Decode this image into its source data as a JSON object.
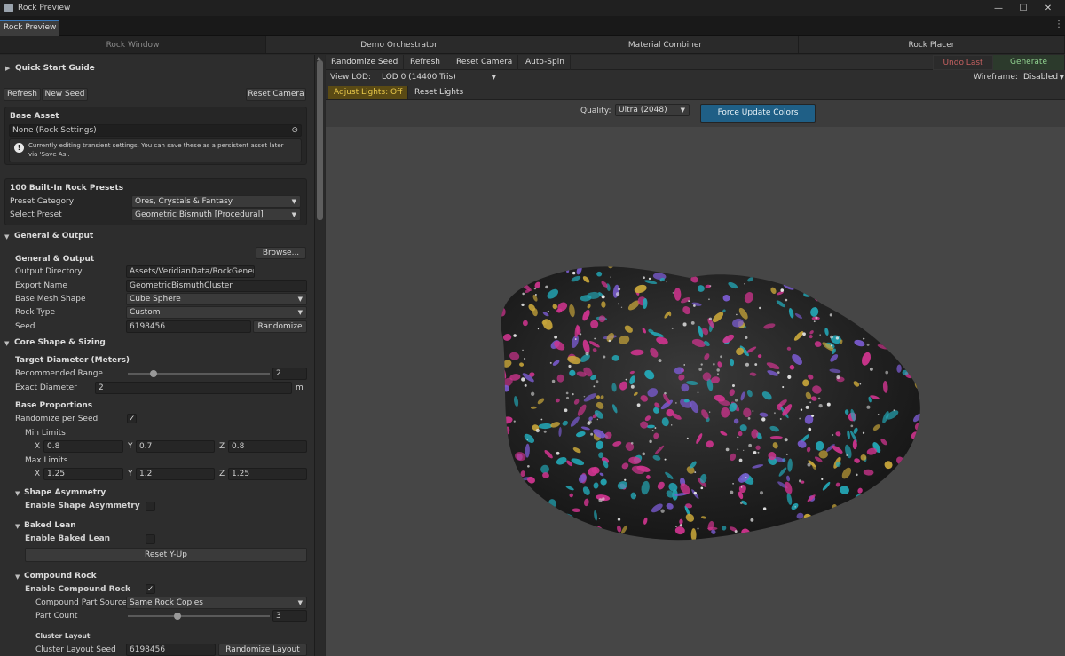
{
  "window": {
    "title": "Rock Preview",
    "controls": {
      "minimize": "—",
      "maximize": "☐",
      "close": "✕"
    }
  },
  "tabs": {
    "active": "Rock Preview",
    "menu": "⋮"
  },
  "nav": {
    "items": [
      "Rock Window",
      "Demo Orchestrator",
      "Material Combiner",
      "Rock Placer"
    ]
  },
  "left": {
    "quick_start": "Quick Start Guide",
    "buttons": {
      "refresh": "Refresh",
      "new_seed": "New Seed",
      "reset_camera": "Reset Camera"
    },
    "base_asset": {
      "title": "Base Asset",
      "value": "None (Rock Settings)",
      "info_line1": "Currently editing transient settings. You can save these as a persistent asset later",
      "info_line2": "via 'Save As'."
    },
    "presets": {
      "title": "100 Built-In Rock Presets",
      "category_label": "Preset Category",
      "category_value": "Ores, Crystals & Fantasy",
      "preset_label": "Select Preset",
      "preset_value": "Geometric Bismuth [Procedural]"
    },
    "general": {
      "section": "General & Output",
      "browse": "Browse...",
      "sub": "General & Output",
      "output_dir_label": "Output Directory",
      "output_dir_value": "Assets/VeridianData/RockGenera",
      "export_label": "Export Name",
      "export_value": "GeometricBismuthCluster",
      "mesh_label": "Base Mesh Shape",
      "mesh_value": "Cube Sphere",
      "type_label": "Rock Type",
      "type_value": "Custom",
      "seed_label": "Seed",
      "seed_value": "6198456",
      "randomize": "Randomize"
    },
    "core": {
      "section": "Core Shape & Sizing",
      "target": "Target Diameter (Meters)",
      "range_label": "Recommended Range",
      "range_value": "2",
      "range_fraction": 0.18,
      "exact_label": "Exact Diameter",
      "exact_value": "2",
      "exact_unit": "m",
      "proportions": "Base Proportions",
      "rand_label": "Randomize per Seed",
      "rand_checked": true,
      "min": "Min Limits",
      "max": "Max Limits",
      "x": "X",
      "y": "Y",
      "z": "Z",
      "min_x": "0.8",
      "min_y": "0.7",
      "min_z": "0.8",
      "max_x": "1.25",
      "max_y": "1.2",
      "max_z": "1.25"
    },
    "asym": {
      "section": "Shape Asymmetry",
      "enable": "Enable Shape Asymmetry",
      "checked": false
    },
    "lean": {
      "section": "Baked Lean",
      "enable": "Enable Baked Lean",
      "checked": false,
      "reset": "Reset Y-Up"
    },
    "compound": {
      "section": "Compound Rock",
      "enable": "Enable Compound Rock",
      "checked": true,
      "source_label": "Compound Part Source",
      "source_value": "Same Rock Copies",
      "count_label": "Part Count",
      "count_value": "3",
      "count_fraction": 0.35,
      "cluster": "Cluster Layout",
      "cluster_seed_label": "Cluster Layout Seed",
      "cluster_seed_value": "6198456",
      "randomize_layout": "Randomize Layout"
    }
  },
  "toolbar": {
    "randomize_seed": "Randomize Seed",
    "refresh": "Refresh",
    "reset_camera": "Reset Camera",
    "auto_spin": "Auto-Spin",
    "undo_last": "Undo Last",
    "generate_prefab": "Generate Prefab",
    "view_lod_label": "View LOD:",
    "view_lod_value": "LOD 0 (14400 Tris)",
    "wireframe_label": "Wireframe:",
    "wireframe_value": "Disabled",
    "adjust_lights": "Adjust Lights: Off",
    "reset_lights": "Reset Lights",
    "quality_label": "Quality:",
    "quality_value": "Ultra (2048)",
    "force_update": "Force Update Colors"
  },
  "colors": {
    "accent_blue": "#1f5f86",
    "adjust_bg": "#5a4a14",
    "undo_text": "#c46060",
    "generate_text": "#8fd08f",
    "spot_pink": "#d0348f",
    "spot_cyan": "#23a9b8",
    "spot_gold": "#c8a63a",
    "spot_purple": "#7a5bd0"
  }
}
